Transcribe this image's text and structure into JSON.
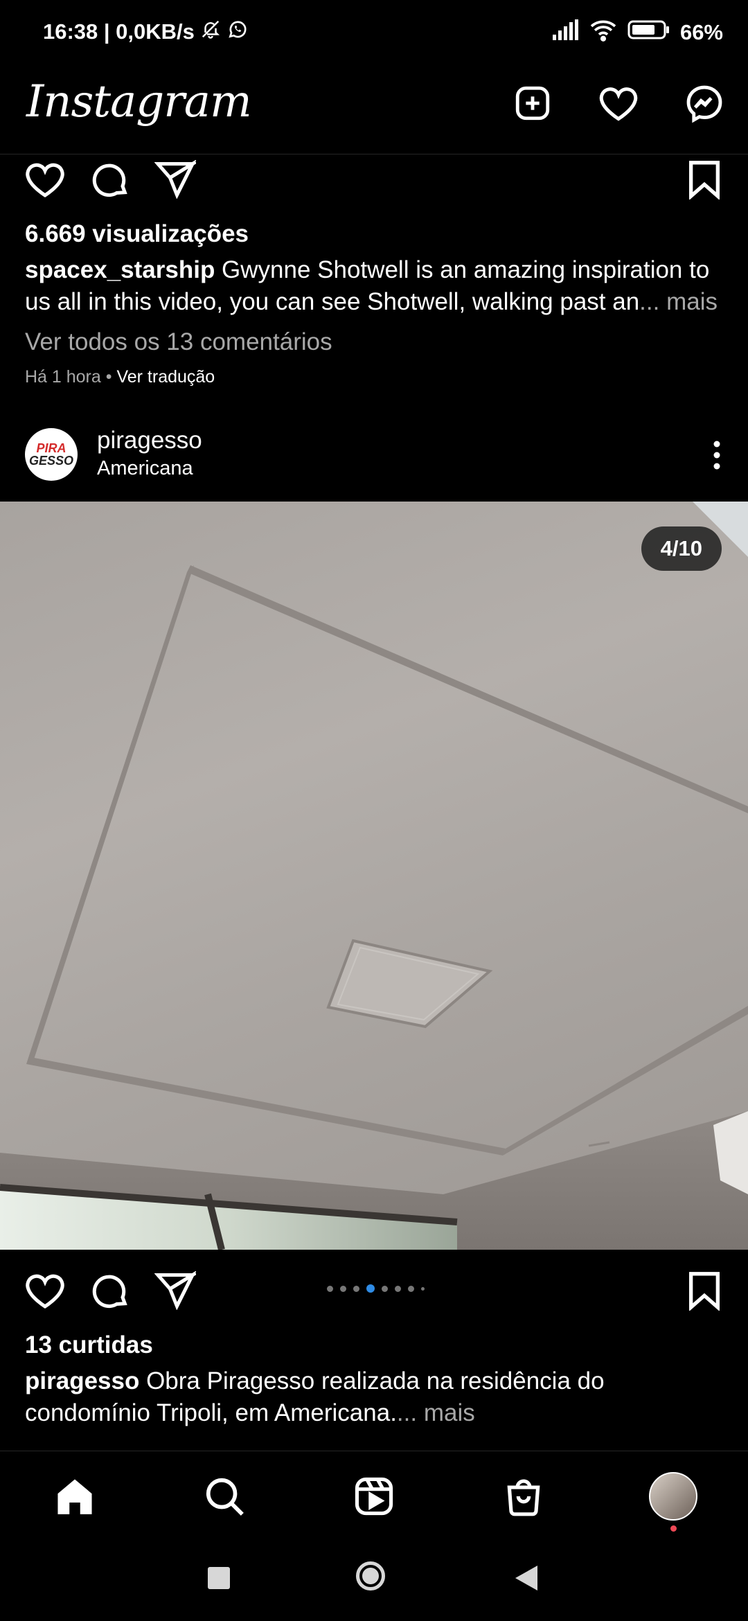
{
  "status_bar": {
    "left_text": "16:38 | 0,0KB/s",
    "battery": "66%"
  },
  "app": {
    "logo": "Instagram"
  },
  "top_icons": [
    "new-post-icon",
    "heart-icon",
    "messenger-icon"
  ],
  "previous_post": {
    "views": "6.669 visualizações",
    "username": "spacex_starship",
    "caption_line1": " Gwynne Shotwell is an amazing inspiration to",
    "caption_line2": "us all in this video, you can see Shotwell, walking past an",
    "more": "... mais",
    "comments_link": "Ver todos os 13 comentários",
    "time": "Há 1 hora",
    "separator": " • ",
    "translate": "Ver tradução"
  },
  "post": {
    "username": "piragesso",
    "location": "Americana",
    "avatar_text_1": "PIRA",
    "avatar_text_2": "GESSO",
    "image_counter": "4/10",
    "carousel_total": 8,
    "carousel_active": 3,
    "likes": "13 curtidas",
    "caption_line1": " Obra Piragesso realizada na residência do",
    "caption_line2": "condomínio Tripoli, em Americana.",
    "more": "... mais"
  },
  "bottom_nav": [
    "home-icon",
    "search-icon",
    "reels-icon",
    "shop-icon",
    "profile-avatar"
  ],
  "colors": {
    "accent": "#2f8ce6",
    "notification": "#ed4956",
    "muted": "#a8a8a8"
  }
}
